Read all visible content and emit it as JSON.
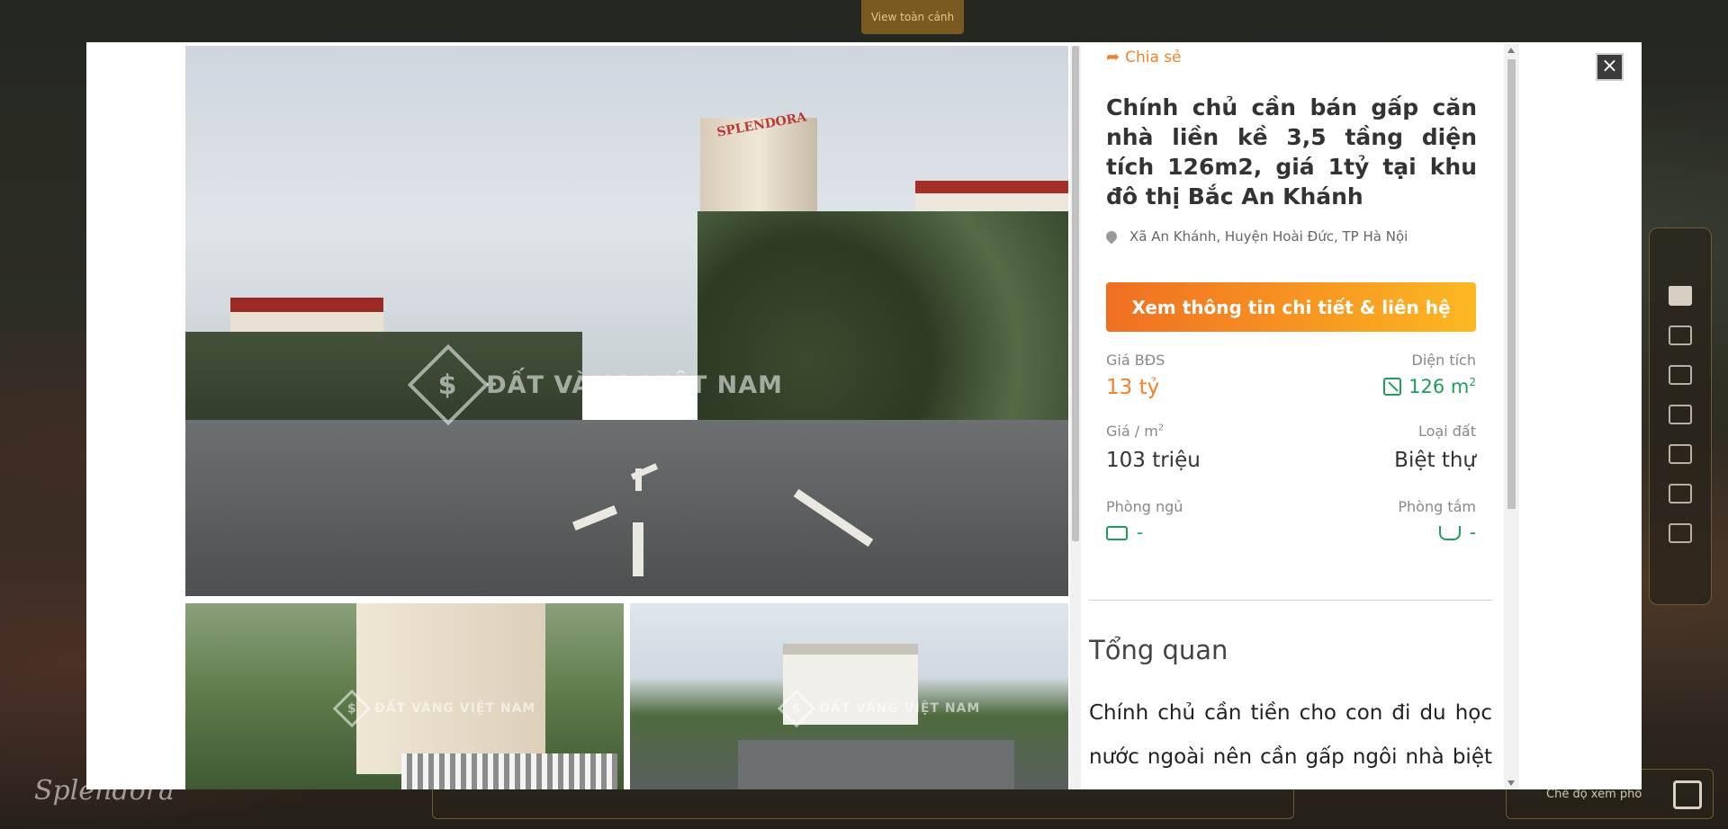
{
  "background": {
    "top_button": "View toàn cảnh",
    "brand": "Splendora",
    "mode_button": "Chế độ xem phố"
  },
  "modal": {
    "close_label": "×",
    "gallery": {
      "watermark": "ĐẤT VÀNG VIỆT NAM",
      "building_sign": "SPLENDORA"
    },
    "listing": {
      "share_label": "Chia sẻ",
      "title": "Chính chủ cần bán gấp căn nhà liền kề 3,5 tầng diện tích 126m2, giá 1tỷ tại khu đô thị Bắc An Khánh",
      "address": "Xã An Khánh, Huyện Hoài Đức, TP Hà Nội",
      "cta_label": "Xem thông tin chi tiết & liên hệ",
      "metrics": {
        "price_label": "Giá BĐS",
        "price_value": "13 tỷ",
        "area_label": "Diện tích",
        "area_value": "126 m",
        "area_unit_sup": "2",
        "price_per_m2_label": "Giá / m",
        "price_per_m2_sup": "2",
        "price_per_m2_value": "103 triệu",
        "land_type_label": "Loại đất",
        "land_type_value": "Biệt thự",
        "bedrooms_label": "Phòng ngủ",
        "bedrooms_value": "-",
        "bathrooms_label": "Phòng tắm",
        "bathrooms_value": "-"
      },
      "overview_title": "Tổng quan",
      "overview_text": "Chính chủ cần tiền cho con đi du học nước ngoài nên cần gấp ngôi nhà biệt thự liền kề"
    }
  },
  "colors": {
    "accent_orange": "#f1812a",
    "accent_green": "#1f9d5a",
    "cta_gradient_start": "#f06f22",
    "cta_gradient_end": "#fcb823"
  }
}
